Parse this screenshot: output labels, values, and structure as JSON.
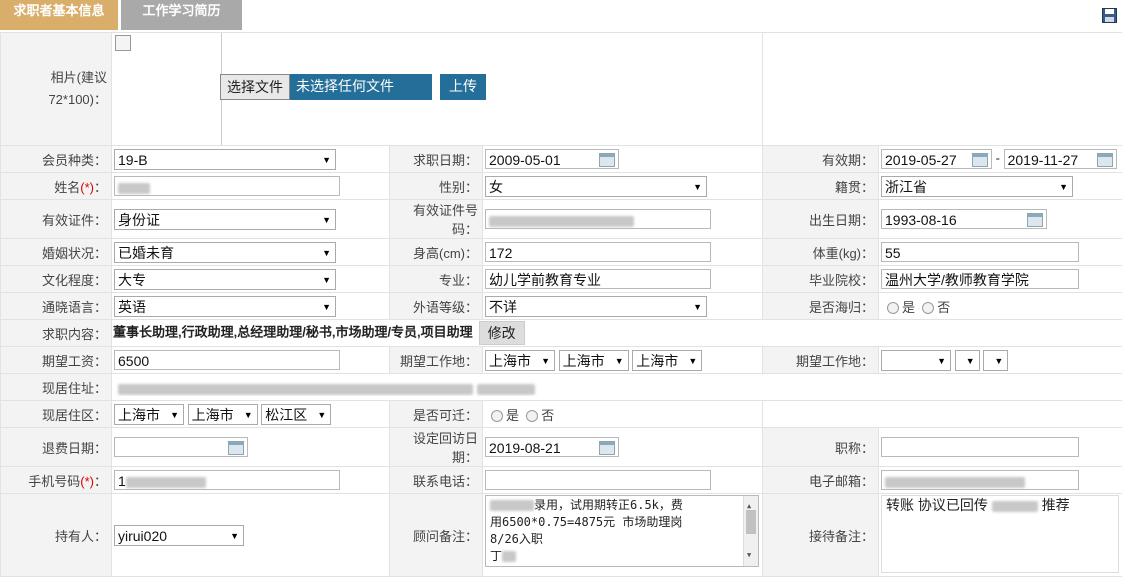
{
  "tabs": [
    "求职者基本信息",
    "工作学习简历"
  ],
  "photo": {
    "label": "相片(建议72*100)：",
    "choose_file": "选择文件",
    "file_status": "未选择任何文件",
    "upload": "上传"
  },
  "member_type": {
    "label": "会员种类：",
    "value": "19-B"
  },
  "job_date": {
    "label": "求职日期：",
    "value": "2009-05-01"
  },
  "validity": {
    "label": "有效期：",
    "start": "2019-05-27",
    "sep": "-",
    "end": "2019-11-27"
  },
  "name": {
    "label": "姓名",
    "req": "(*)",
    "colon": "："
  },
  "gender": {
    "label": "性别：",
    "value": "女"
  },
  "native_place": {
    "label": "籍贯：",
    "value": "浙江省"
  },
  "id_type": {
    "label": "有效证件：",
    "value": "身份证"
  },
  "id_number": {
    "label": "有效证件号码："
  },
  "birth_date": {
    "label": "出生日期：",
    "value": "1993-08-16"
  },
  "marital": {
    "label": "婚姻状况：",
    "value": "已婚未育"
  },
  "height": {
    "label": "身高(cm)：",
    "value": "172"
  },
  "weight": {
    "label": "体重(kg)：",
    "value": "55"
  },
  "education": {
    "label": "文化程度：",
    "value": "大专"
  },
  "major": {
    "label": "专业：",
    "value": "幼儿学前教育专业"
  },
  "school": {
    "label": "毕业院校：",
    "value": "温州大学/教师教育学院"
  },
  "language": {
    "label": "通晓语言：",
    "value": "英语"
  },
  "foreign_level": {
    "label": "外语等级：",
    "value": "不详"
  },
  "overseas": {
    "label": "是否海归：",
    "yes": "是",
    "no": "否"
  },
  "job_content": {
    "label": "求职内容：",
    "value": "董事长助理,行政助理,总经理助理/秘书,市场助理/专员,项目助理",
    "edit": "修改"
  },
  "expected_salary": {
    "label": "期望工资：",
    "value": "6500"
  },
  "expected_location": {
    "label": "期望工作地：",
    "province": "上海市",
    "city": "上海市",
    "district": "上海市"
  },
  "expected_location2": {
    "label": "期望工作地："
  },
  "address": {
    "label": "现居住址："
  },
  "residence_area": {
    "label": "现居住区：",
    "province": "上海市",
    "city": "上海市",
    "district": "松江区"
  },
  "relocate": {
    "label": "是否可迁：",
    "yes": "是",
    "no": "否"
  },
  "refund_date": {
    "label": "退费日期："
  },
  "callback_date": {
    "label": "设定回访日期：",
    "value": "2019-08-21"
  },
  "title_field": {
    "label": "职称："
  },
  "mobile": {
    "label": "手机号码",
    "req": "(*)",
    "colon": "：",
    "prefix": "1"
  },
  "phone": {
    "label": "联系电话："
  },
  "email": {
    "label": "电子邮箱："
  },
  "holder": {
    "label": "持有人：",
    "value": "yirui020"
  },
  "advisor_note": {
    "label": "顾问备注：",
    "line1": "录用，试用期转正6.5k，费",
    "line2": "用6500*0.75=4875元  市场助理岗",
    "line3": "8/26入职",
    "line4": "丁"
  },
  "reception_note": {
    "label": "接待备注：",
    "text1": "转账 协议已回传",
    "text2": "推荐"
  },
  "colors": {
    "tab_active": "#d8ae6a",
    "tab_inactive": "#a9a9a9",
    "upload_bg": "#246f99",
    "required": "#dd0000"
  }
}
